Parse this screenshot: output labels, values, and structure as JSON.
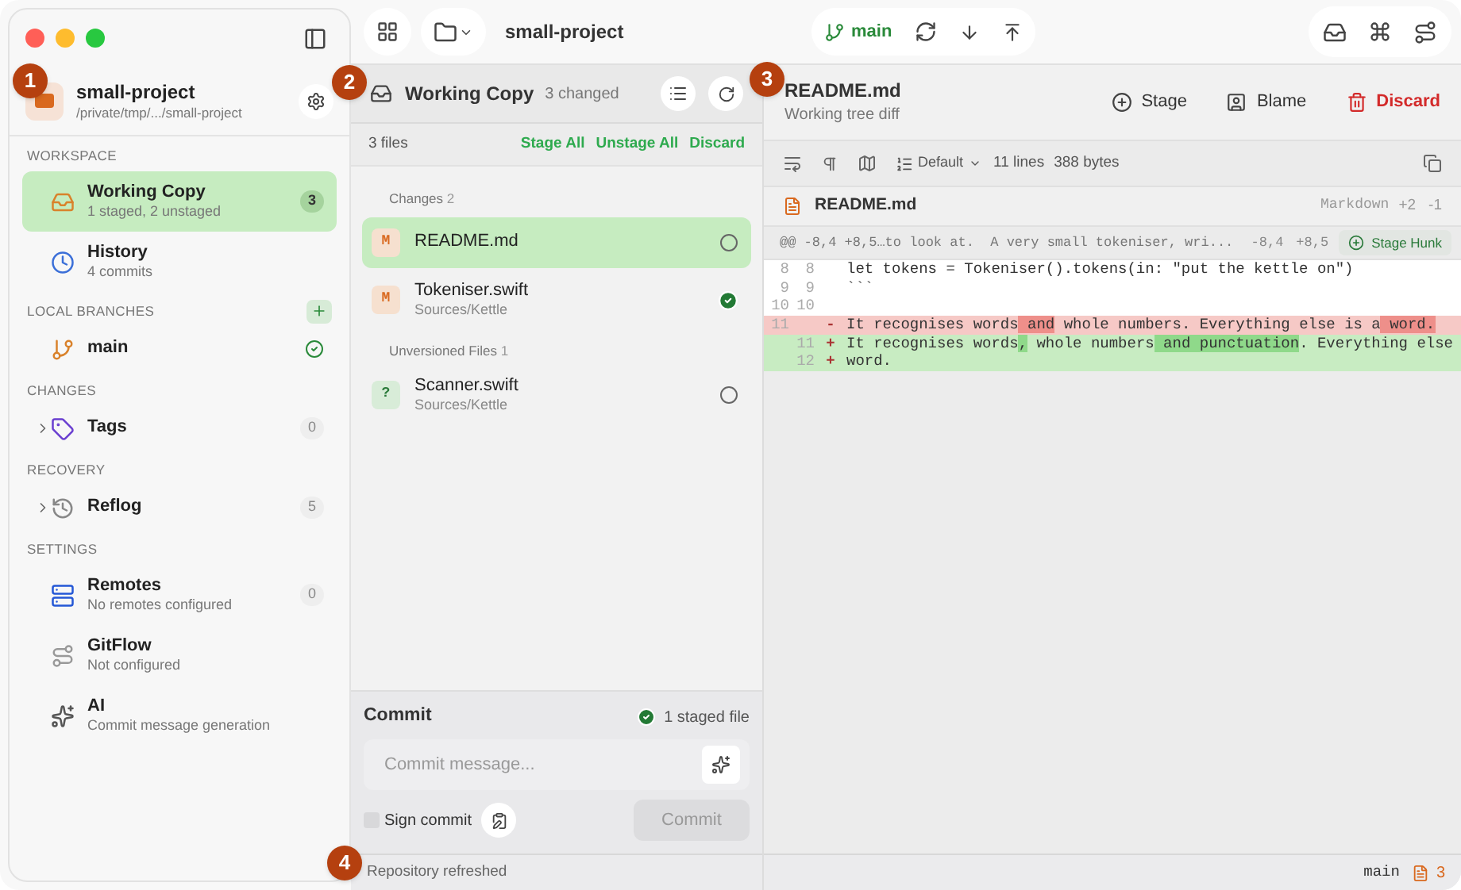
{
  "window": {
    "title": "small-project"
  },
  "toolbar": {
    "branch": "main"
  },
  "callouts": [
    "1",
    "2",
    "3",
    "4"
  ],
  "sidebar": {
    "repo": {
      "name": "small-project",
      "path": "/private/tmp/.../small-project"
    },
    "sections": [
      {
        "heading": "WORKSPACE",
        "items": [
          {
            "kind": "working_copy",
            "label": "Working Copy",
            "subtitle": "1 staged, 2 unstaged",
            "count": "3",
            "selected": true
          },
          {
            "kind": "history",
            "label": "History",
            "subtitle": "4 commits",
            "selected": false
          }
        ]
      },
      {
        "heading": "LOCAL BRANCHES",
        "add_button": true,
        "items": [
          {
            "kind": "branch",
            "label": "main",
            "current": true,
            "selected": false
          }
        ]
      },
      {
        "heading": "CHANGES",
        "items": [
          {
            "kind": "tags",
            "label": "Tags",
            "count": "0",
            "expanded": false,
            "selected": false
          }
        ]
      },
      {
        "heading": "RECOVERY",
        "items": [
          {
            "kind": "reflog",
            "label": "Reflog",
            "count": "5",
            "expanded": false,
            "selected": false
          }
        ]
      },
      {
        "heading": "SETTINGS",
        "items": [
          {
            "kind": "remotes",
            "label": "Remotes",
            "subtitle": "No remotes configured",
            "count": "0",
            "selected": false
          },
          {
            "kind": "gitflow",
            "label": "GitFlow",
            "subtitle": "Not configured",
            "selected": false
          },
          {
            "kind": "ai",
            "label": "AI",
            "subtitle": "Commit message generation",
            "selected": false
          }
        ]
      }
    ]
  },
  "working_copy": {
    "title": "Working Copy",
    "changed": "3 changed",
    "files_count": "3 files",
    "actions": [
      "Stage All",
      "Unstage All",
      "Discard"
    ],
    "groups": [
      {
        "heading": "Changes",
        "count": "2",
        "files": [
          {
            "kind": "modified",
            "status": "M",
            "name": "README.md",
            "selected": true,
            "staged": false
          },
          {
            "kind": "modified",
            "status": "M",
            "name": "Tokeniser.swift",
            "path": "Sources/Kettle",
            "selected": false,
            "staged": true
          }
        ]
      },
      {
        "heading": "Unversioned Files",
        "count": "1",
        "files": [
          {
            "kind": "untracked",
            "status": "?",
            "name": "Scanner.swift",
            "path": "Sources/Kettle",
            "selected": false,
            "staged": false
          }
        ]
      }
    ],
    "commit": {
      "title": "Commit",
      "staged": "1 staged file",
      "placeholder": "Commit message...",
      "sign_label": "Sign commit",
      "sign_checked": false,
      "button": "Commit",
      "button_disabled": true
    },
    "status": "Repository refreshed"
  },
  "diff": {
    "title": "README.md",
    "subtitle": "Working tree diff",
    "actions": [
      {
        "kind": "stage",
        "label": "Stage"
      },
      {
        "kind": "blame",
        "label": "Blame"
      },
      {
        "kind": "discard",
        "label": "Discard"
      }
    ],
    "mode": "Default",
    "lines": "11 lines",
    "bytes": "388 bytes",
    "file": {
      "name": "README.md",
      "language": "Markdown",
      "added": "+2",
      "removed": "-1"
    },
    "hunk": {
      "header": "@@ -8,4 +8,5…to look at.  A very small tokeniser, wri...",
      "old_range": "-8,4",
      "new_range": "+8,5",
      "button": "Stage Hunk"
    },
    "rows": [
      {
        "kind": "context",
        "old": "8",
        "new": "8",
        "segments": [
          {
            "text": "let tokens = Tokeniser().tokens(in: \"put the kettle on\")",
            "highlight": false
          }
        ]
      },
      {
        "kind": "context",
        "old": "9",
        "new": "9",
        "segments": [
          {
            "text": "```",
            "highlight": false
          }
        ]
      },
      {
        "kind": "context",
        "old": "10",
        "new": "10",
        "segments": []
      },
      {
        "kind": "removed",
        "old": "11",
        "sign": "-",
        "segments": [
          {
            "text": "It recognises words",
            "highlight": false
          },
          {
            "text": " and",
            "highlight": true
          },
          {
            "text": " whole numbers. Everything else is a",
            "highlight": false
          },
          {
            "text": " word.",
            "highlight": true
          }
        ]
      },
      {
        "kind": "added",
        "new": "11",
        "sign": "+",
        "segments": [
          {
            "text": "It recognises words",
            "highlight": false
          },
          {
            "text": ",",
            "highlight": true
          },
          {
            "text": " whole numbers",
            "highlight": false
          },
          {
            "text": " and punctuation",
            "highlight": true
          },
          {
            "text": ". Everything else",
            "highlight": false
          }
        ]
      },
      {
        "kind": "added",
        "new": "12",
        "sign": "+",
        "segments": [
          {
            "text": "word.",
            "highlight": false
          }
        ]
      }
    ],
    "status": {
      "branch": "main",
      "files": "3"
    }
  }
}
